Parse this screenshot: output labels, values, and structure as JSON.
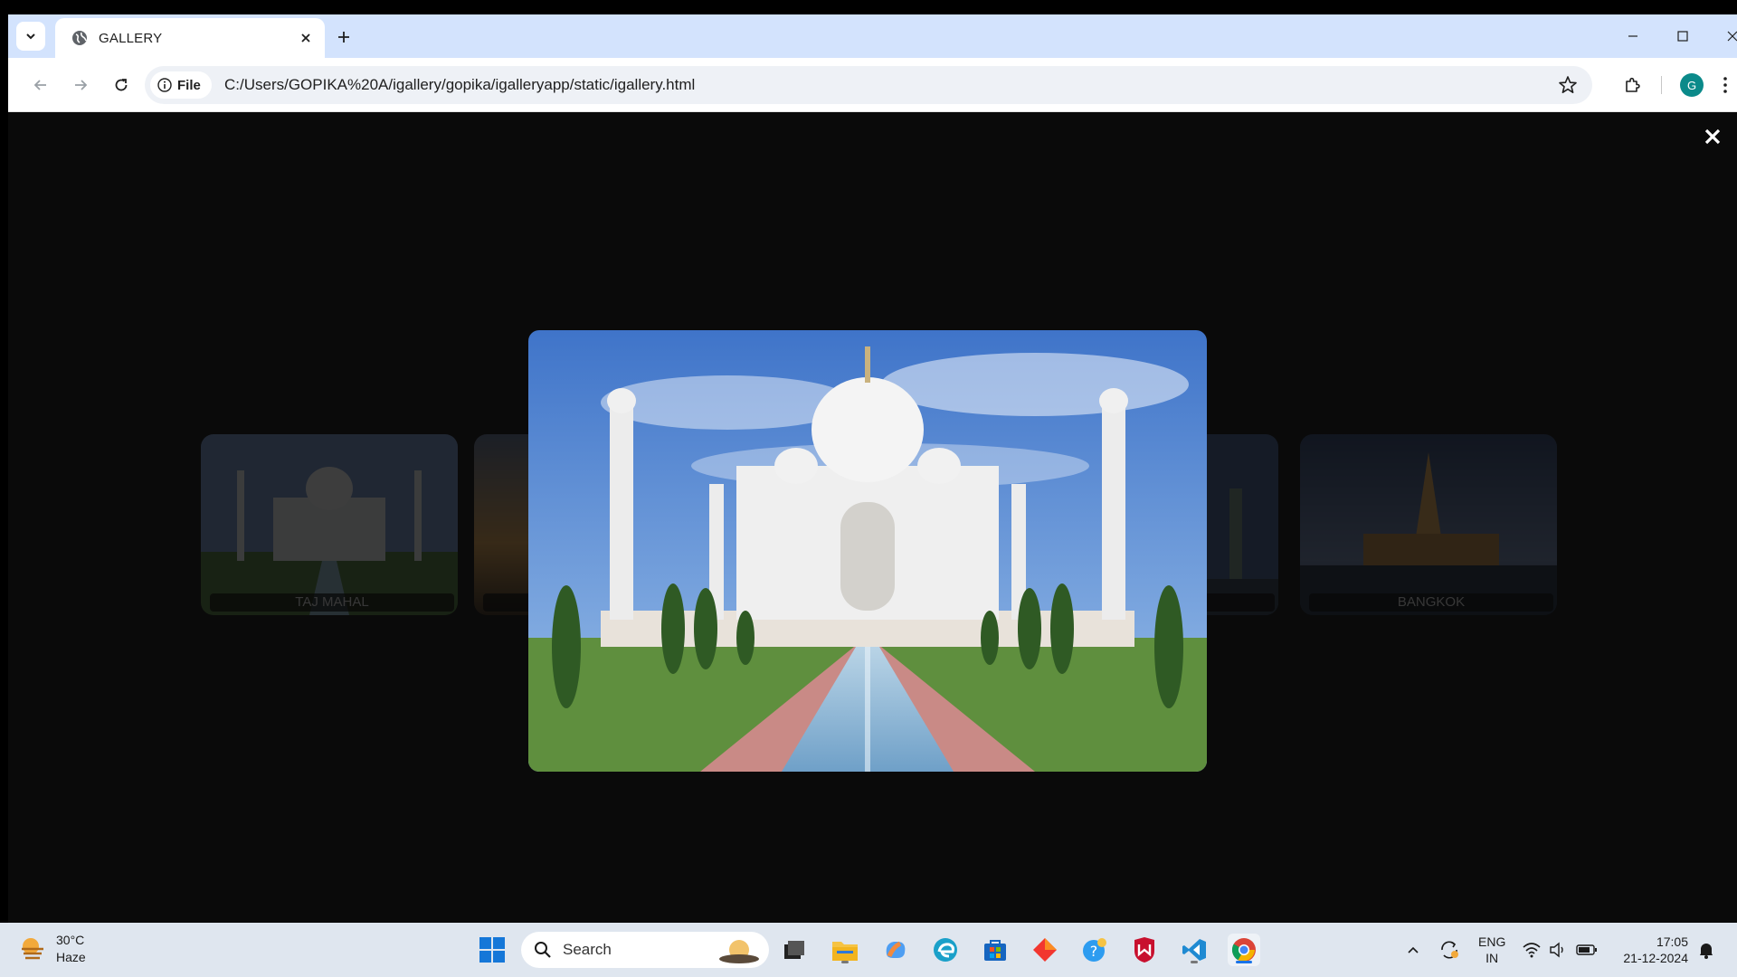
{
  "browser": {
    "tab_title": "GALLERY",
    "chip_label": "File",
    "url": "C:/Users/GOPIKA%20A/igallery/gopika/igalleryapp/static/igallery.html",
    "profile_initial": "G"
  },
  "gallery": {
    "cards": [
      {
        "label": "TAJ MAHAL"
      },
      {
        "label": ""
      },
      {
        "label": ""
      },
      {
        "label": "BANGKOK"
      }
    ],
    "lightbox_close": "✕"
  },
  "taskbar": {
    "weather_temp": "30°C",
    "weather_desc": "Haze",
    "search_label": "Search",
    "lang_line1": "ENG",
    "lang_line2": "IN",
    "time": "17:05",
    "date": "21-12-2024"
  },
  "colors": {
    "tabstrip": "#d3e3fd",
    "page_bg": "#0a0a0a",
    "taskbar": "#dfe6ef",
    "avatar": "#0b8a8a"
  }
}
